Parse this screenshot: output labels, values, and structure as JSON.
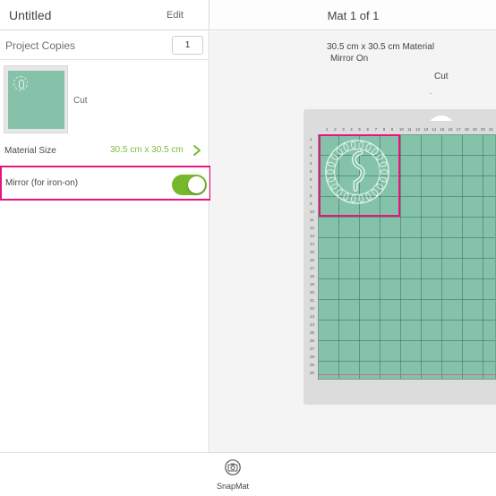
{
  "left_panel": {
    "title": "Untitled",
    "edit_label": "Edit",
    "project_copies_label": "Project Copies",
    "project_copies_value": "1",
    "mat_thumbnail_label": "Cut",
    "material_size_label": "Material Size",
    "material_size_value": "30.5 cm x 30.5 cm",
    "mirror_label": "Mirror (for iron-on)",
    "mirror_on": true
  },
  "right_panel": {
    "mat_title": "Mat 1 of 1",
    "material_info": "30.5 cm x 30.5 cm Material",
    "mirror_status": "Mirror On",
    "mode": "Cut",
    "dot": "."
  },
  "bottom_bar": {
    "snapmat_label": "SnapMat"
  },
  "icons": {
    "chevron": "chevron-right-icon",
    "camera": "camera-icon"
  },
  "colors": {
    "accent_green": "#76b82a",
    "highlight_pink": "#e8157e",
    "mat_green": "#84c3a9"
  },
  "rulers": {
    "top": [
      "1",
      "2",
      "3",
      "4",
      "5",
      "6",
      "7",
      "8",
      "9",
      "10",
      "11",
      "12",
      "13",
      "14",
      "15",
      "16",
      "17",
      "18",
      "19",
      "20",
      "21",
      "22"
    ],
    "left": [
      "1",
      "2",
      "3",
      "4",
      "5",
      "6",
      "7",
      "8",
      "9",
      "10",
      "11",
      "12",
      "13",
      "14",
      "15",
      "16",
      "17",
      "18",
      "19",
      "20",
      "21",
      "22",
      "23",
      "24",
      "25",
      "26",
      "27",
      "28",
      "29",
      "30"
    ]
  }
}
